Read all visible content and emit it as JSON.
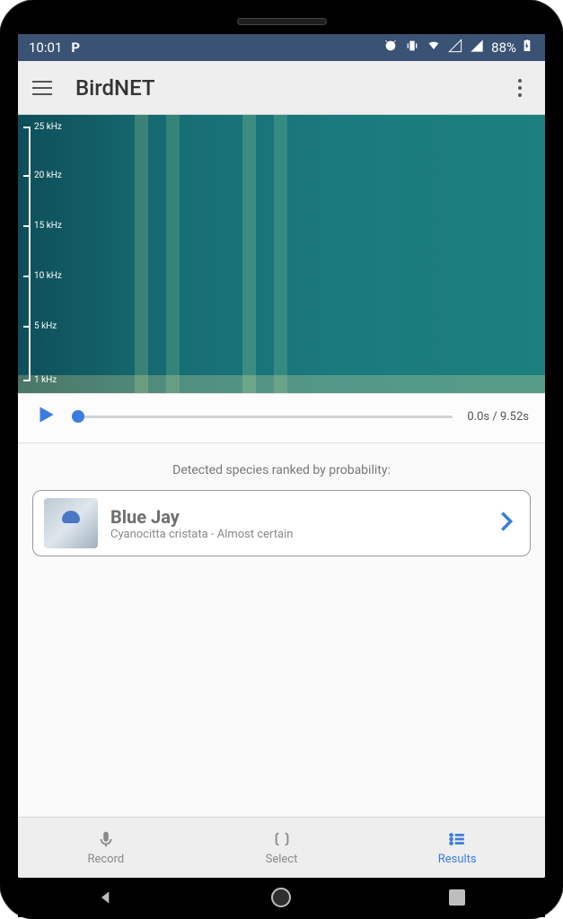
{
  "status": {
    "time": "10:01",
    "battery": "88%"
  },
  "appbar": {
    "title": "BirdNET"
  },
  "spectrogram": {
    "ticks": [
      "25 kHz",
      "20 kHz",
      "15 kHz",
      "10 kHz",
      "5 kHz",
      "1 kHz"
    ]
  },
  "player": {
    "time_display": "0.0s / 9.52s"
  },
  "results": {
    "header": "Detected species ranked by probability:",
    "items": [
      {
        "name": "Blue Jay",
        "subtitle": "Cyanocitta cristata - Almost certain"
      }
    ]
  },
  "tabs": {
    "record": "Record",
    "select": "Select",
    "results": "Results"
  }
}
